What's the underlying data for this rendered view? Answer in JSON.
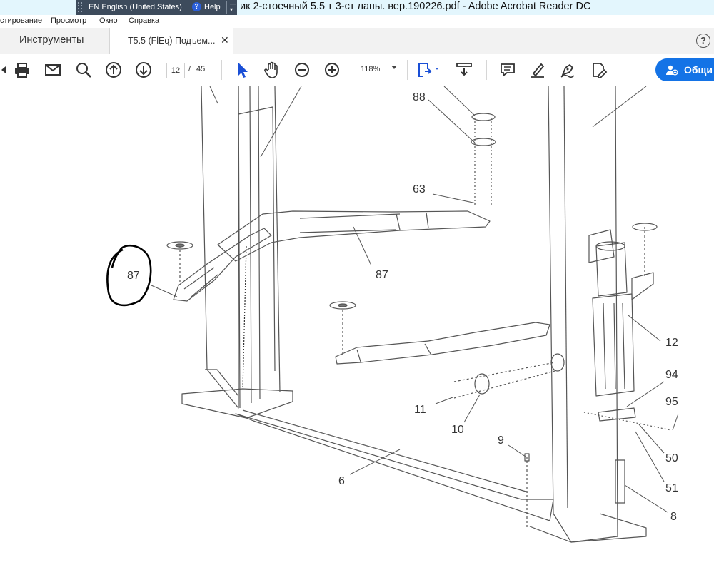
{
  "window": {
    "title": "ик 2-стоечный 5.5 т 3-ст лапы. вер.190226.pdf - Adobe Acrobat Reader DC"
  },
  "language_bar": {
    "language": "EN English (United States)",
    "help": "Help"
  },
  "menu": [
    "стирование",
    "Просмотр",
    "Окно",
    "Справка"
  ],
  "tabs": {
    "tools": "Инструменты",
    "document": "T5.5 (FlEq) Подъем..."
  },
  "toolbar": {
    "page_current": "12",
    "page_separator": "/",
    "page_total": "45",
    "zoom": "118%",
    "share_label": "Общи"
  },
  "document": {
    "callouts": [
      {
        "id": "c88",
        "text": "88"
      },
      {
        "id": "c63",
        "text": "63"
      },
      {
        "id": "c87a",
        "text": "87"
      },
      {
        "id": "c87b",
        "text": "87"
      },
      {
        "id": "c12",
        "text": "12"
      },
      {
        "id": "c94",
        "text": "94"
      },
      {
        "id": "c95",
        "text": "95"
      },
      {
        "id": "c11",
        "text": "11"
      },
      {
        "id": "c10",
        "text": "10"
      },
      {
        "id": "c9",
        "text": "9"
      },
      {
        "id": "c50",
        "text": "50"
      },
      {
        "id": "c6",
        "text": "6"
      },
      {
        "id": "c51",
        "text": "51"
      },
      {
        "id": "c8",
        "text": "8"
      }
    ]
  },
  "colors": {
    "accent": "#1473e6",
    "titlebar": "#e3f6fd",
    "language_bar": "#3d4b5c"
  }
}
